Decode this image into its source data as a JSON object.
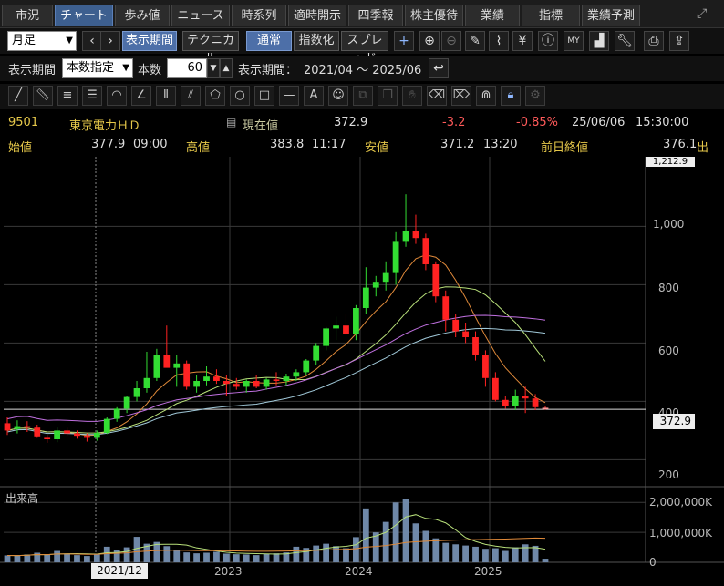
{
  "tabs": [
    {
      "label": "市況",
      "active": false
    },
    {
      "label": "チャート",
      "active": true
    },
    {
      "label": "歩み値",
      "active": false
    },
    {
      "label": "ニュース",
      "active": false
    },
    {
      "label": "時系列",
      "active": false
    },
    {
      "label": "適時開示",
      "active": false
    },
    {
      "label": "四季報",
      "active": false
    },
    {
      "label": "株主優待",
      "active": false
    },
    {
      "label": "業績",
      "active": false
    },
    {
      "label": "指標",
      "active": false
    },
    {
      "label": "業績予測",
      "active": false
    }
  ],
  "toolbar": {
    "period_select": "月足",
    "btn_display_period": "表示期間",
    "btn_technical": "テクニカル",
    "btn_normal": "通常",
    "btn_index": "指数化",
    "btn_spread": "スプレッド",
    "yen_icon_text": "¥"
  },
  "period_row": {
    "label": "表示期間",
    "mode_select": "本数指定",
    "count_label": "本数",
    "count_value": "60",
    "range_label": "表示期間：",
    "range_value": "2021/04 ～ 2025/06"
  },
  "quote": {
    "code": "9501",
    "name": "東京電力ＨＤ",
    "current_label": "現在値",
    "current_value": "372.9",
    "change": "-3.2",
    "change_pct": "-0.85%",
    "date": "25/06/06",
    "time": "15:30:00",
    "open_label": "始値",
    "open_value": "377.9",
    "open_time": "09:00",
    "high_label": "高値",
    "high_value": "383.8",
    "high_time": "11:17",
    "low_label": "安値",
    "low_value": "371.2",
    "low_time": "13:20",
    "prev_label": "前日終値",
    "prev_value": "376.1",
    "prev_suffix": "出"
  },
  "chart_labels": {
    "volume_title": "出来高",
    "price_ticks": [
      "1,000",
      "800",
      "600",
      "400",
      "200"
    ],
    "top_tick": "1,212.9",
    "volume_ticks": [
      "2,000,000K",
      "1,000,000K",
      "0"
    ],
    "x_ticks": [
      "2023",
      "2024",
      "2025"
    ],
    "cursor_x_label": "2021/12",
    "price_tag": "372.9"
  },
  "chart_data": {
    "type": "candlestick",
    "ylim": [
      120,
      1220
    ],
    "volume_ylim": [
      0,
      2100000
    ],
    "candles": [
      {
        "o": 325,
        "h": 345,
        "l": 285,
        "c": 300,
        "v": 230000
      },
      {
        "o": 305,
        "h": 335,
        "l": 290,
        "c": 315,
        "v": 220000
      },
      {
        "o": 315,
        "h": 332,
        "l": 295,
        "c": 310,
        "v": 260000
      },
      {
        "o": 310,
        "h": 320,
        "l": 275,
        "c": 280,
        "v": 320000
      },
      {
        "o": 275,
        "h": 285,
        "l": 258,
        "c": 270,
        "v": 250000
      },
      {
        "o": 270,
        "h": 310,
        "l": 260,
        "c": 300,
        "v": 380000
      },
      {
        "o": 300,
        "h": 310,
        "l": 282,
        "c": 290,
        "v": 290000
      },
      {
        "o": 290,
        "h": 300,
        "l": 272,
        "c": 282,
        "v": 240000
      },
      {
        "o": 282,
        "h": 290,
        "l": 262,
        "c": 275,
        "v": 210000
      },
      {
        "o": 275,
        "h": 300,
        "l": 265,
        "c": 292,
        "v": 280000
      },
      {
        "o": 292,
        "h": 345,
        "l": 288,
        "c": 340,
        "v": 520000
      },
      {
        "o": 340,
        "h": 380,
        "l": 330,
        "c": 375,
        "v": 420000
      },
      {
        "o": 375,
        "h": 420,
        "l": 360,
        "c": 415,
        "v": 500000
      },
      {
        "o": 415,
        "h": 470,
        "l": 400,
        "c": 445,
        "v": 850000
      },
      {
        "o": 445,
        "h": 570,
        "l": 430,
        "c": 480,
        "v": 620000
      },
      {
        "o": 480,
        "h": 580,
        "l": 470,
        "c": 560,
        "v": 680000
      },
      {
        "o": 560,
        "h": 660,
        "l": 520,
        "c": 515,
        "v": 540000
      },
      {
        "o": 515,
        "h": 560,
        "l": 450,
        "c": 530,
        "v": 420000
      },
      {
        "o": 530,
        "h": 540,
        "l": 440,
        "c": 450,
        "v": 330000
      },
      {
        "o": 450,
        "h": 490,
        "l": 430,
        "c": 470,
        "v": 300000
      },
      {
        "o": 470,
        "h": 520,
        "l": 455,
        "c": 485,
        "v": 320000
      },
      {
        "o": 485,
        "h": 510,
        "l": 460,
        "c": 470,
        "v": 350000
      },
      {
        "o": 470,
        "h": 490,
        "l": 420,
        "c": 460,
        "v": 290000
      },
      {
        "o": 460,
        "h": 480,
        "l": 440,
        "c": 450,
        "v": 270000
      },
      {
        "o": 450,
        "h": 475,
        "l": 430,
        "c": 470,
        "v": 260000
      },
      {
        "o": 470,
        "h": 490,
        "l": 445,
        "c": 450,
        "v": 240000
      },
      {
        "o": 450,
        "h": 480,
        "l": 440,
        "c": 475,
        "v": 280000
      },
      {
        "o": 475,
        "h": 500,
        "l": 455,
        "c": 470,
        "v": 300000
      },
      {
        "o": 470,
        "h": 495,
        "l": 455,
        "c": 485,
        "v": 330000
      },
      {
        "o": 485,
        "h": 510,
        "l": 470,
        "c": 500,
        "v": 520000
      },
      {
        "o": 500,
        "h": 545,
        "l": 490,
        "c": 540,
        "v": 480000
      },
      {
        "o": 540,
        "h": 600,
        "l": 525,
        "c": 590,
        "v": 560000
      },
      {
        "o": 590,
        "h": 655,
        "l": 575,
        "c": 650,
        "v": 620000
      },
      {
        "o": 650,
        "h": 690,
        "l": 610,
        "c": 660,
        "v": 540000
      },
      {
        "o": 660,
        "h": 700,
        "l": 625,
        "c": 630,
        "v": 470000
      },
      {
        "o": 630,
        "h": 730,
        "l": 610,
        "c": 720,
        "v": 840000
      },
      {
        "o": 720,
        "h": 860,
        "l": 700,
        "c": 790,
        "v": 1800000
      },
      {
        "o": 790,
        "h": 830,
        "l": 760,
        "c": 810,
        "v": 1000000
      },
      {
        "o": 810,
        "h": 880,
        "l": 780,
        "c": 840,
        "v": 1350000
      },
      {
        "o": 840,
        "h": 980,
        "l": 800,
        "c": 950,
        "v": 2000000
      },
      {
        "o": 950,
        "h": 1110,
        "l": 930,
        "c": 985,
        "v": 2100000
      },
      {
        "o": 985,
        "h": 1040,
        "l": 940,
        "c": 960,
        "v": 1300000
      },
      {
        "o": 960,
        "h": 975,
        "l": 850,
        "c": 870,
        "v": 1050000
      },
      {
        "o": 870,
        "h": 880,
        "l": 740,
        "c": 760,
        "v": 800000
      },
      {
        "o": 760,
        "h": 780,
        "l": 640,
        "c": 680,
        "v": 650000
      },
      {
        "o": 680,
        "h": 700,
        "l": 620,
        "c": 640,
        "v": 600000
      },
      {
        "o": 640,
        "h": 670,
        "l": 600,
        "c": 620,
        "v": 560000
      },
      {
        "o": 620,
        "h": 640,
        "l": 540,
        "c": 560,
        "v": 520000
      },
      {
        "o": 560,
        "h": 575,
        "l": 450,
        "c": 480,
        "v": 450000
      },
      {
        "o": 480,
        "h": 500,
        "l": 400,
        "c": 405,
        "v": 470000
      },
      {
        "o": 405,
        "h": 420,
        "l": 375,
        "c": 385,
        "v": 380000
      },
      {
        "o": 385,
        "h": 440,
        "l": 370,
        "c": 420,
        "v": 500000
      },
      {
        "o": 420,
        "h": 450,
        "l": 360,
        "c": 410,
        "v": 600000
      },
      {
        "o": 410,
        "h": 425,
        "l": 370,
        "c": 380,
        "v": 550000
      },
      {
        "o": 378,
        "h": 384,
        "l": 371,
        "c": 373,
        "v": 120000
      }
    ],
    "ma_short_color": "#e08a3a",
    "ma_mid_color": "#b8e07a",
    "ma_long1_color": "#c070e0",
    "ma_long2_color": "#a0c8d8",
    "up_color": "#33dd33",
    "down_color": "#ff2222"
  }
}
